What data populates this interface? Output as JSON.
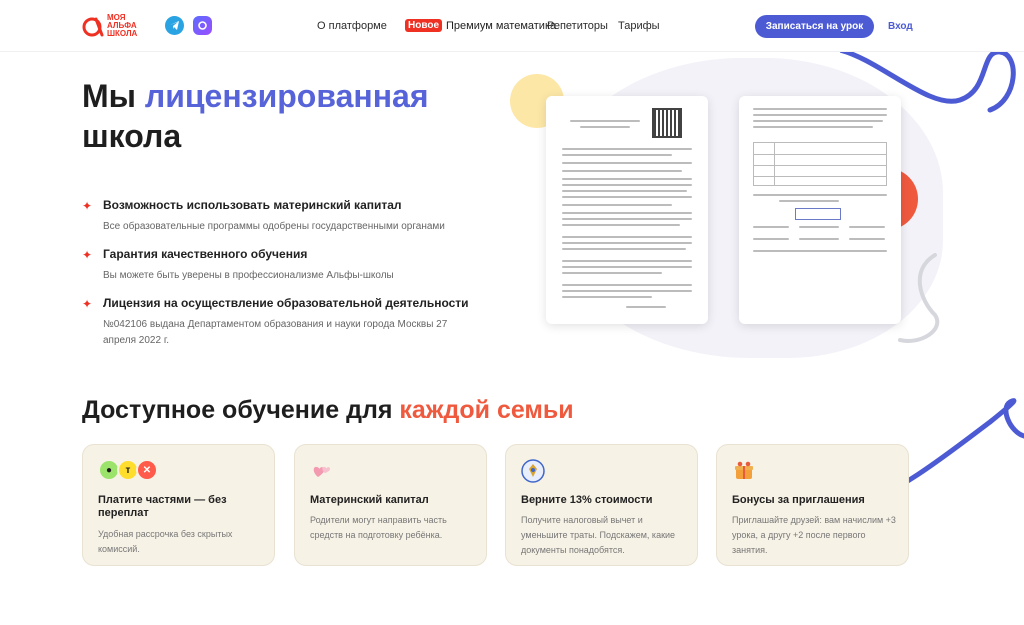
{
  "header": {
    "logo_text": "МОЯ АЛЬФА ШКОЛА",
    "nav": [
      "О платформе",
      "Премиум математика",
      "Репетиторы",
      "Тарифы"
    ],
    "new_badge": "Новое",
    "cta": "Записаться на урок",
    "login": "Вход"
  },
  "hero": {
    "title_part1": "Мы ",
    "title_accent": "лицензированная",
    "title_part2": "школа",
    "features": [
      {
        "title": "Возможность использовать материнский капитал",
        "subtitle": "Все образовательные программы одобрены государственными органами"
      },
      {
        "title": "Гарантия качественного обучения",
        "subtitle": "Вы можете быть уверены в профессионализме Альфы-школы"
      },
      {
        "title": "Лицензия на осуществление образовательной деятельности",
        "subtitle": "№042106 выдана Департаментом образования и науки города Москвы 27 апреля 2022 г."
      }
    ]
  },
  "section": {
    "title_part1": "Доступное обучение для ",
    "title_accent": "каждой семьи"
  },
  "cards": [
    {
      "icon": "payment-partners-icon",
      "title": "Платите частями — без переплат",
      "text": "Удобная рассрочка без скрытых комиссий."
    },
    {
      "icon": "hearts-icon",
      "title": "Материнский капитал",
      "text": "Родители могут направить часть средств на подготовку ребёнка."
    },
    {
      "icon": "tax-emblem-icon",
      "title": "Верните 13% стоимости",
      "text": "Получите налоговый вычет и уменьшите траты. Подскажем, какие документы понадобятся."
    },
    {
      "icon": "gift-bonus-icon",
      "title": "Бонусы за приглашения",
      "text": "Приглашайте друзей: вам начислим +3 урока, а другу +2 после первого занятия."
    }
  ],
  "colors": {
    "brand_red": "#ef3124",
    "accent_blue": "#5763d8",
    "button": "#4c5bd4",
    "accent_orange": "#ef5a3f",
    "card_bg": "#f7f2e6"
  }
}
